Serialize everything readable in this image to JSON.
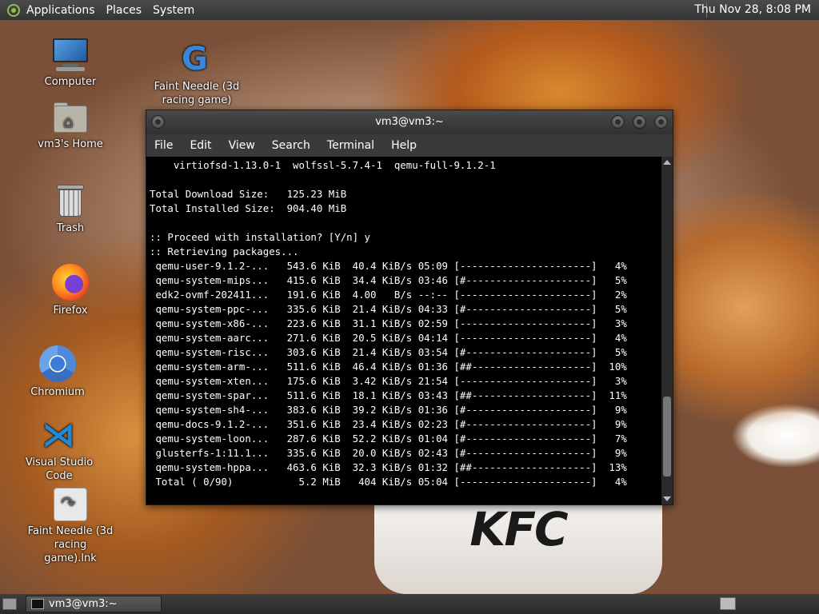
{
  "top_panel": {
    "menus": [
      "Applications",
      "Places",
      "System"
    ],
    "clock": "Thu Nov 28,  8:08 PM"
  },
  "desktop": {
    "icons": [
      {
        "label": "Computer",
        "icon": "computer-icon"
      },
      {
        "label": "Faint Needle (3d racing game)",
        "icon": "gdevelop-icon"
      },
      {
        "label": "vm3's Home",
        "icon": "home-folder-icon"
      },
      {
        "label": "Trash",
        "icon": "trash-icon"
      },
      {
        "label": "Firefox",
        "icon": "firefox-icon"
      },
      {
        "label": "Chromium",
        "icon": "chromium-icon"
      },
      {
        "label": "Visual Studio Code",
        "icon": "vscode-icon"
      },
      {
        "label": "Faint Needle (3d racing game).lnk",
        "icon": "shortcut-icon"
      }
    ],
    "wallpaper_brand": "KFC"
  },
  "window": {
    "title": "vm3@vm3:~",
    "menu": [
      "File",
      "Edit",
      "View",
      "Search",
      "Terminal",
      "Help"
    ],
    "terminal_lines": [
      "    virtiofsd-1.13.0-1  wolfssl-5.7.4-1  qemu-full-9.1.2-1",
      "",
      "Total Download Size:   125.23 MiB",
      "Total Installed Size:  904.40 MiB",
      "",
      ":: Proceed with installation? [Y/n] y",
      ":: Retrieving packages...",
      " qemu-user-9.1.2-...   543.6 KiB  40.4 KiB/s 05:09 [----------------------]   4%",
      " qemu-system-mips...   415.6 KiB  34.4 KiB/s 03:46 [#---------------------]   5%",
      " edk2-ovmf-202411...   191.6 KiB  4.00   B/s --:-- [----------------------]   2%",
      " qemu-system-ppc-...   335.6 KiB  21.4 KiB/s 04:33 [#---------------------]   5%",
      " qemu-system-x86-...   223.6 KiB  31.1 KiB/s 02:59 [----------------------]   3%",
      " qemu-system-aarc...   271.6 KiB  20.5 KiB/s 04:14 [----------------------]   4%",
      " qemu-system-risc...   303.6 KiB  21.4 KiB/s 03:54 [#---------------------]   5%",
      " qemu-system-arm-...   511.6 KiB  46.4 KiB/s 01:36 [##--------------------]  10%",
      " qemu-system-xten...   175.6 KiB  3.42 KiB/s 21:54 [----------------------]   3%",
      " qemu-system-spar...   511.6 KiB  18.1 KiB/s 03:43 [##--------------------]  11%",
      " qemu-system-sh4-...   383.6 KiB  39.2 KiB/s 01:36 [#---------------------]   9%",
      " qemu-docs-9.1.2-...   351.6 KiB  23.4 KiB/s 02:23 [#---------------------]   9%",
      " qemu-system-loon...   287.6 KiB  52.2 KiB/s 01:04 [#---------------------]   7%",
      " glusterfs-1:11.1...   335.6 KiB  20.0 KiB/s 02:43 [#---------------------]   9%",
      " qemu-system-hppa...   463.6 KiB  32.3 KiB/s 01:32 [##--------------------]  13%",
      " Total ( 0/90)           5.2 MiB   404 KiB/s 05:04 [----------------------]   4%"
    ]
  },
  "bottom_panel": {
    "task_label": "vm3@vm3:~"
  }
}
